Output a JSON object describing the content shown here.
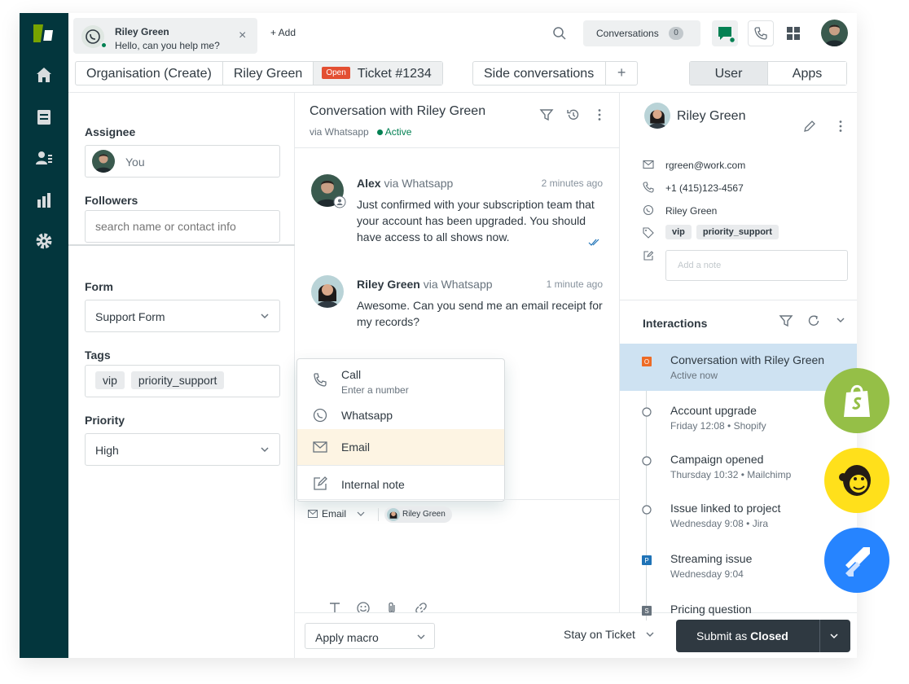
{
  "top_tab": {
    "name": "Riley Green",
    "preview": "Hello, can you help me?"
  },
  "add_tab_label": "+ Add",
  "conversations_button": {
    "label": "Conversations",
    "count": "0"
  },
  "breadcrumbs": {
    "organisation": "Organisation (Create)",
    "requester": "Riley Green",
    "status_badge": "Open",
    "ticket": "Ticket #1234"
  },
  "side_conversations": {
    "label": "Side conversations",
    "plus": "+"
  },
  "context_tabs": {
    "user": "User",
    "apps": "Apps"
  },
  "properties": {
    "assignee_label": "Assignee",
    "assignee_value": "You",
    "followers_label": "Followers",
    "followers_placeholder": "search name or contact info",
    "form_label": "Form",
    "form_value": "Support Form",
    "tags_label": "Tags",
    "tags": [
      "vip",
      "priority_support"
    ],
    "priority_label": "Priority",
    "priority_value": "High"
  },
  "conversation": {
    "title": "Conversation with Riley Green",
    "via": "via Whatsapp",
    "status": "Active",
    "messages": [
      {
        "author": "Alex",
        "via": "via Whatsapp",
        "time": "2 minutes ago",
        "text": "Just confirmed with your subscription team that your account has been upgraded. You should have access to all shows now."
      },
      {
        "author": "Riley Green",
        "via": "via Whatsapp",
        "time": "1 minute ago",
        "text": "Awesome. Can you send me an email receipt for my records?"
      }
    ]
  },
  "channel_menu": {
    "call": {
      "label": "Call",
      "hint": "Enter a number"
    },
    "whatsapp": "Whatsapp",
    "email": "Email",
    "internal_note": "Internal note"
  },
  "composer": {
    "channel": "Email",
    "recipient": "Riley Green"
  },
  "footer": {
    "macro": "Apply macro",
    "stay": "Stay on Ticket",
    "submit_prefix": "Submit as ",
    "submit_status": "Closed"
  },
  "customer": {
    "name": "Riley Green",
    "email": "rgreen@work.com",
    "phone": "+1 (415)123-4567",
    "whatsapp": "Riley Green",
    "tags": [
      "vip",
      "priority_support"
    ],
    "note_placeholder": "Add a note"
  },
  "interactions": {
    "title": "Interactions",
    "events": [
      {
        "title": "Conversation with Riley Green",
        "sub": "Active now",
        "marker": "O"
      },
      {
        "title": "Account upgrade",
        "sub": "Friday 12:08 • Shopify"
      },
      {
        "title": "Campaign opened",
        "sub": "Thursday 10:32 • Mailchimp"
      },
      {
        "title": "Issue linked to project",
        "sub": "Wednesday 9:08 • Jira"
      },
      {
        "title": "Streaming issue",
        "sub": "Wednesday 9:04",
        "marker": "P"
      },
      {
        "title": "Pricing question",
        "sub": "",
        "marker": "S"
      }
    ]
  },
  "colors": {
    "nav": "#03363d",
    "accent": "#038153",
    "selected": "#cee2f2",
    "badge": "#e34f32",
    "shopify": "#95bf47",
    "mailchimp": "#ffe01b",
    "jira": "#2684ff"
  }
}
